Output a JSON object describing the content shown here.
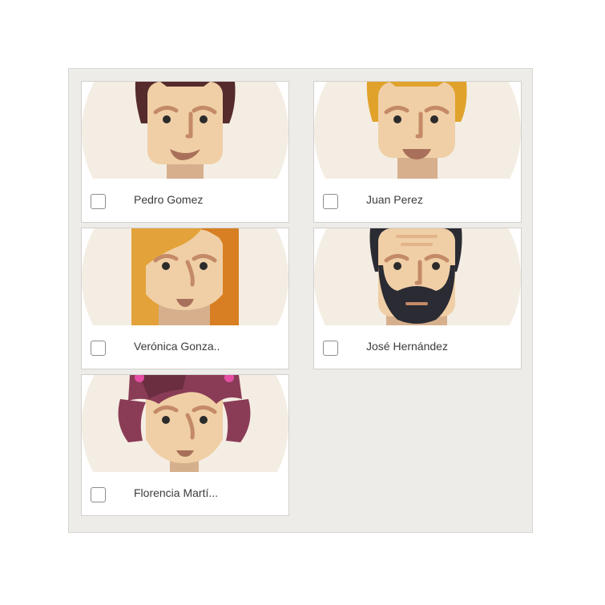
{
  "people": [
    {
      "name": "Pedro Gomez",
      "avatar": "man-brown-hair-smiling-icon",
      "checked": false
    },
    {
      "name": "Juan Perez",
      "avatar": "man-blond-hair-icon",
      "checked": false
    },
    {
      "name": "Verónica Gonza..",
      "avatar": "woman-long-orange-hair-icon",
      "checked": false
    },
    {
      "name": "José Hernández",
      "avatar": "man-bearded-icon",
      "checked": false
    },
    {
      "name": "Florencia Martí...",
      "avatar": "woman-purple-hair-icon",
      "checked": false
    }
  ],
  "colors": {
    "panel_bg": "#edece9",
    "avatar_bg": "#f4ede3",
    "skin": "#f0cfa6",
    "text": "#3b3b3b"
  }
}
